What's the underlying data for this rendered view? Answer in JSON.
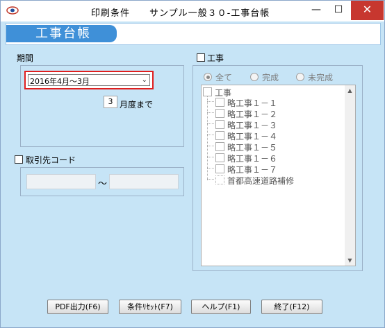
{
  "window": {
    "title": "印刷条件　　サンプル一般３０-工事台帳",
    "minimize_label": "—",
    "maximize_label": "☐",
    "close_label": "✕"
  },
  "header": {
    "tab_label": "工事台帳"
  },
  "period": {
    "label": "期間",
    "selected": "2016年4月〜3月",
    "months_value": "3",
    "months_suffix": "月度まで"
  },
  "client_code": {
    "label": "取引先コード",
    "from_value": "",
    "tilde": "〜",
    "to_value": ""
  },
  "construction": {
    "label": "工事",
    "radios": [
      {
        "label": "全て",
        "selected": true
      },
      {
        "label": "完成",
        "selected": false
      },
      {
        "label": "未完成",
        "selected": false
      }
    ],
    "tree_root": "工事",
    "tree_items": [
      "略工事１－１",
      "略工事１－２",
      "略工事１－３",
      "略工事１－４",
      "略工事１－５",
      "略工事１－６",
      "略工事１－７",
      "首都高速道路補修"
    ]
  },
  "buttons": {
    "pdf": "PDF出力(F6)",
    "reset": "条件ﾘｾｯﾄ(F7)",
    "help": "ヘルプ(F1)",
    "exit": "終了(F12)"
  },
  "colors": {
    "accent": "#3f90d8",
    "highlight": "#e01e1e",
    "background": "#c6e4f6"
  }
}
